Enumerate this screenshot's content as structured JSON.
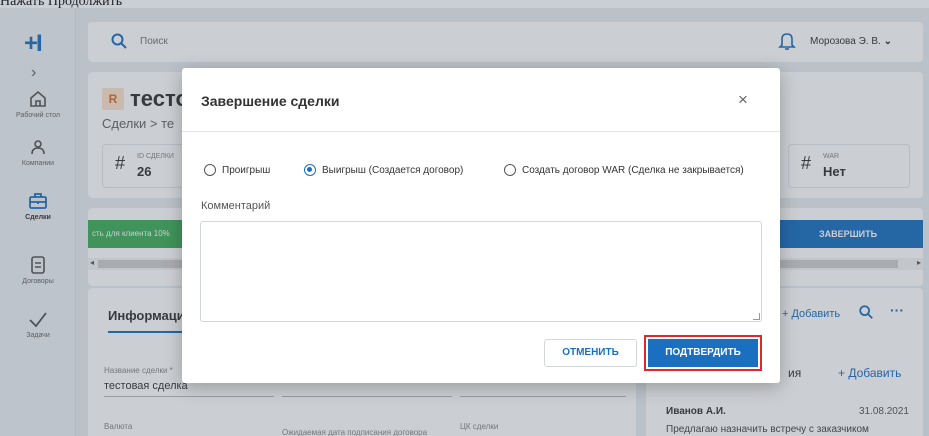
{
  "instruction": "Нажать Продолжить",
  "topbar": {
    "search_placeholder": "Поиск",
    "user_name": "Морозова Э. В."
  },
  "sidebar": {
    "logo": "+I",
    "items": [
      {
        "label": "Рабочий стол",
        "icon": "home-icon"
      },
      {
        "label": "Компании",
        "icon": "company-icon"
      },
      {
        "label": "Сделки",
        "icon": "briefcase-icon"
      },
      {
        "label": "Договоры",
        "icon": "document-icon"
      },
      {
        "label": "Задачи",
        "icon": "check-icon"
      }
    ]
  },
  "deal": {
    "title": "тесто",
    "badge": "R",
    "breadcrumb": "Сделки > те",
    "stats": [
      {
        "label": "ID СДЕЛКИ",
        "value": "26"
      },
      {
        "label": "WAR",
        "value": "Нет"
      }
    ]
  },
  "progress": {
    "stage_text": "сть для клиента 10%",
    "finish_label": "ЗАВЕРШИТЬ"
  },
  "info": {
    "tab": "Информация",
    "fields": [
      {
        "label": "Название сделки *",
        "value": "тестовая сделка"
      },
      {
        "label": "Валюта",
        "value": ""
      },
      {
        "label": "Ожидаемая дата подписания договора",
        "value": ""
      },
      {
        "label": "ЦК сделки",
        "value": ""
      }
    ]
  },
  "side_panel": {
    "add_label": "+ Добавить",
    "section_suffix": "ия",
    "add_label2": "+ Добавить",
    "comment": {
      "author": "Иванов А.И.",
      "date": "31.08.2021",
      "text": "Предлагаю назначить встречу с заказчиком"
    }
  },
  "modal": {
    "title": "Завершение сделки",
    "close": "×",
    "options": [
      {
        "label": "Проигрыш",
        "selected": false
      },
      {
        "label": "Выигрыш (Создается договор)",
        "selected": true
      },
      {
        "label": "Создать договор WAR (Сделка не закрывается)",
        "selected": false
      }
    ],
    "comment_label": "Комментарий",
    "comment_value": "",
    "cancel_label": "ОТМЕНИТЬ",
    "confirm_label": "ПОДТВЕРДИТЬ"
  },
  "colors": {
    "accent": "#1a6fc1",
    "highlight": "#e0262f",
    "success": "#3fae5a"
  }
}
